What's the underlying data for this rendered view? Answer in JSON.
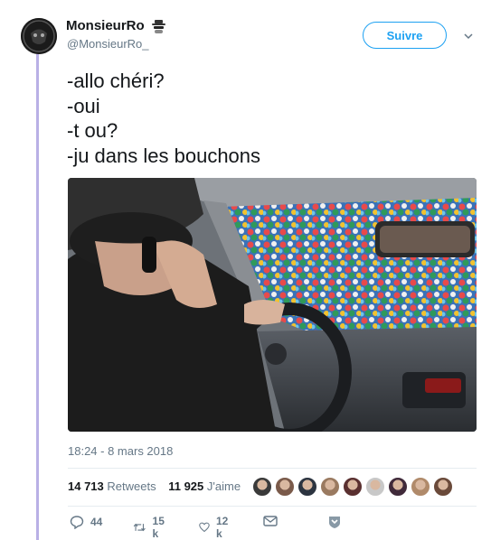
{
  "user": {
    "display_name": "MonsieurRo",
    "handle": "@MonsieurRo_",
    "name_emoji_icon": "spy-icon"
  },
  "header": {
    "follow_label": "Suivre",
    "menu_icon": "chevron-down-icon"
  },
  "tweet": {
    "lines": [
      "-allo chéri?",
      "-oui",
      "-t ou?",
      "-ju dans les bouchons"
    ],
    "media_icon": "photo-driver-in-bottle-caps"
  },
  "meta": {
    "timestamp": "18:24 - 8 mars 2018"
  },
  "stats": {
    "retweets_count": "14 713",
    "retweets_label": "Retweets",
    "likes_count": "11 925",
    "likes_label": "J'aime"
  },
  "liker_faces": [
    "#3a3a3a",
    "#7a5a4a",
    "#2c3440",
    "#9a7a60",
    "#5a3030",
    "#c8c8c8",
    "#402a3a",
    "#b08a6a",
    "#6a4a3a"
  ],
  "actions": {
    "reply_count": "44",
    "retweet_count": "15 k",
    "like_count": "12 k"
  },
  "colors": {
    "accent": "#1da1f2",
    "thread_line": "#b9b0e6",
    "muted": "#657786"
  }
}
